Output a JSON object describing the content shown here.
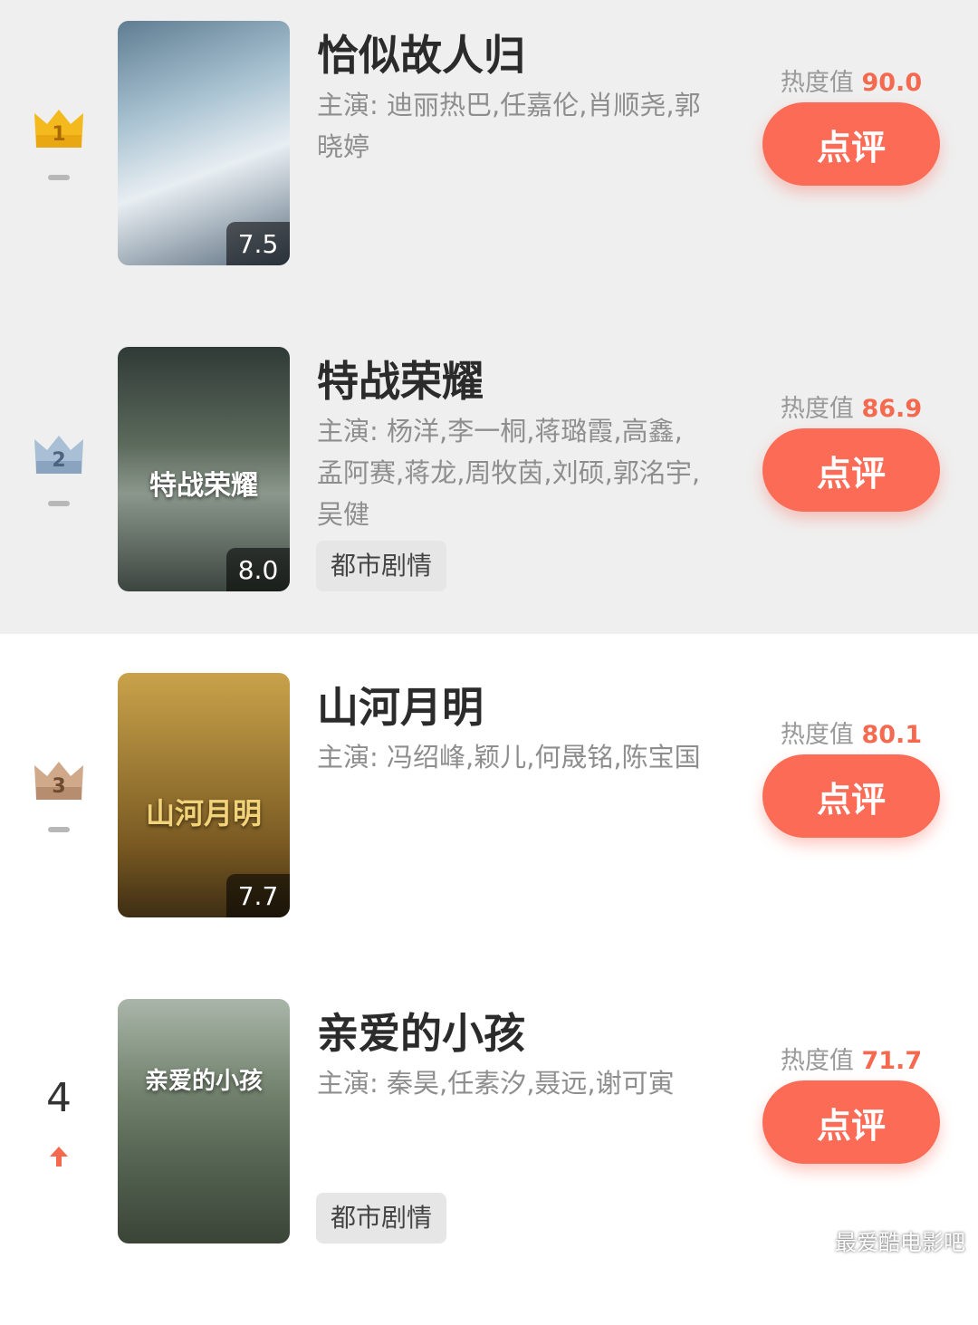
{
  "heat_label": "热度值",
  "review_label": "点评",
  "items": [
    {
      "rank": "1",
      "title": "恰似故人归",
      "cast": "主演: 迪丽热巴,任嘉伦,肖顺尧,郭晓婷",
      "score": "7.5",
      "heat": "90.0",
      "tag": null,
      "crown_color": "#f2b51c",
      "trend": "flat"
    },
    {
      "rank": "2",
      "title": "特战荣耀",
      "cast": "主演: 杨洋,李一桐,蒋璐霞,高鑫,孟阿赛,蒋龙,周牧茵,刘硕,郭洺宇,吴健",
      "score": "8.0",
      "heat": "86.9",
      "tag": "都市剧情",
      "crown_color": "#8fa8c4",
      "trend": "flat",
      "poster_text": "特战荣耀"
    },
    {
      "rank": "3",
      "title": "山河月明",
      "cast": "主演: 冯绍峰,颖儿,何晟铭,陈宝国",
      "score": "7.7",
      "heat": "80.1",
      "tag": null,
      "crown_color": "#c2987a",
      "trend": "flat",
      "poster_text": "山河月明"
    },
    {
      "rank": "4",
      "title": "亲爱的小孩",
      "cast": "主演: 秦昊,任素汐,聂远,谢可寅",
      "score": null,
      "heat": "71.7",
      "tag": "都市剧情",
      "crown_color": null,
      "trend": "up",
      "poster_text": "亲爱的小孩"
    }
  ],
  "colors": {
    "accent": "#fb6b56",
    "heat_value": "#f56a4f",
    "trend_up": "#f56a4f"
  },
  "watermark": "最爱酷电影吧"
}
